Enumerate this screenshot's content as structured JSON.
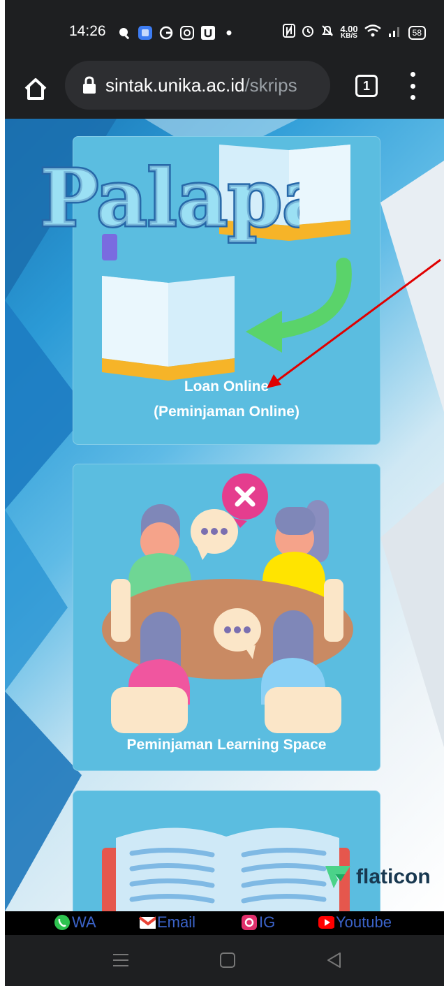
{
  "status_bar": {
    "time": "14:26",
    "left_icons": [
      "search-icon",
      "app-icon",
      "g-icon",
      "instagram-icon",
      "u-icon",
      "dot-icon"
    ],
    "network_speed_value": "4.00",
    "network_speed_unit": "KB/S",
    "battery": "58"
  },
  "browser": {
    "url_domain": "sintak.unika.ac.id",
    "url_path": "/skrips",
    "tab_count": "1"
  },
  "cards": [
    {
      "label_line1": "Loan Online",
      "label_line2": "(Peminjaman Online)"
    },
    {
      "label_line1": "Peminjaman Learning Space"
    },
    {
      "label_line1": ""
    }
  ],
  "logo_text": "Palapa",
  "watermark": "flaticon",
  "footer": {
    "links": [
      {
        "label": "WA",
        "icon": "whatsapp-icon",
        "color": "#2ec34f"
      },
      {
        "label": "Email",
        "icon": "gmail-icon",
        "color": "#e94235"
      },
      {
        "label": "IG",
        "icon": "instagram-icon",
        "color": "#e1306c"
      },
      {
        "label": "Youtube",
        "icon": "youtube-icon",
        "color": "#ff0000"
      }
    ]
  },
  "annotation": {
    "color": "#e00000"
  },
  "colors": {
    "card": "#5bbde0",
    "footer_text": "#3b63c9",
    "bar_bg": "#1e1f21"
  }
}
